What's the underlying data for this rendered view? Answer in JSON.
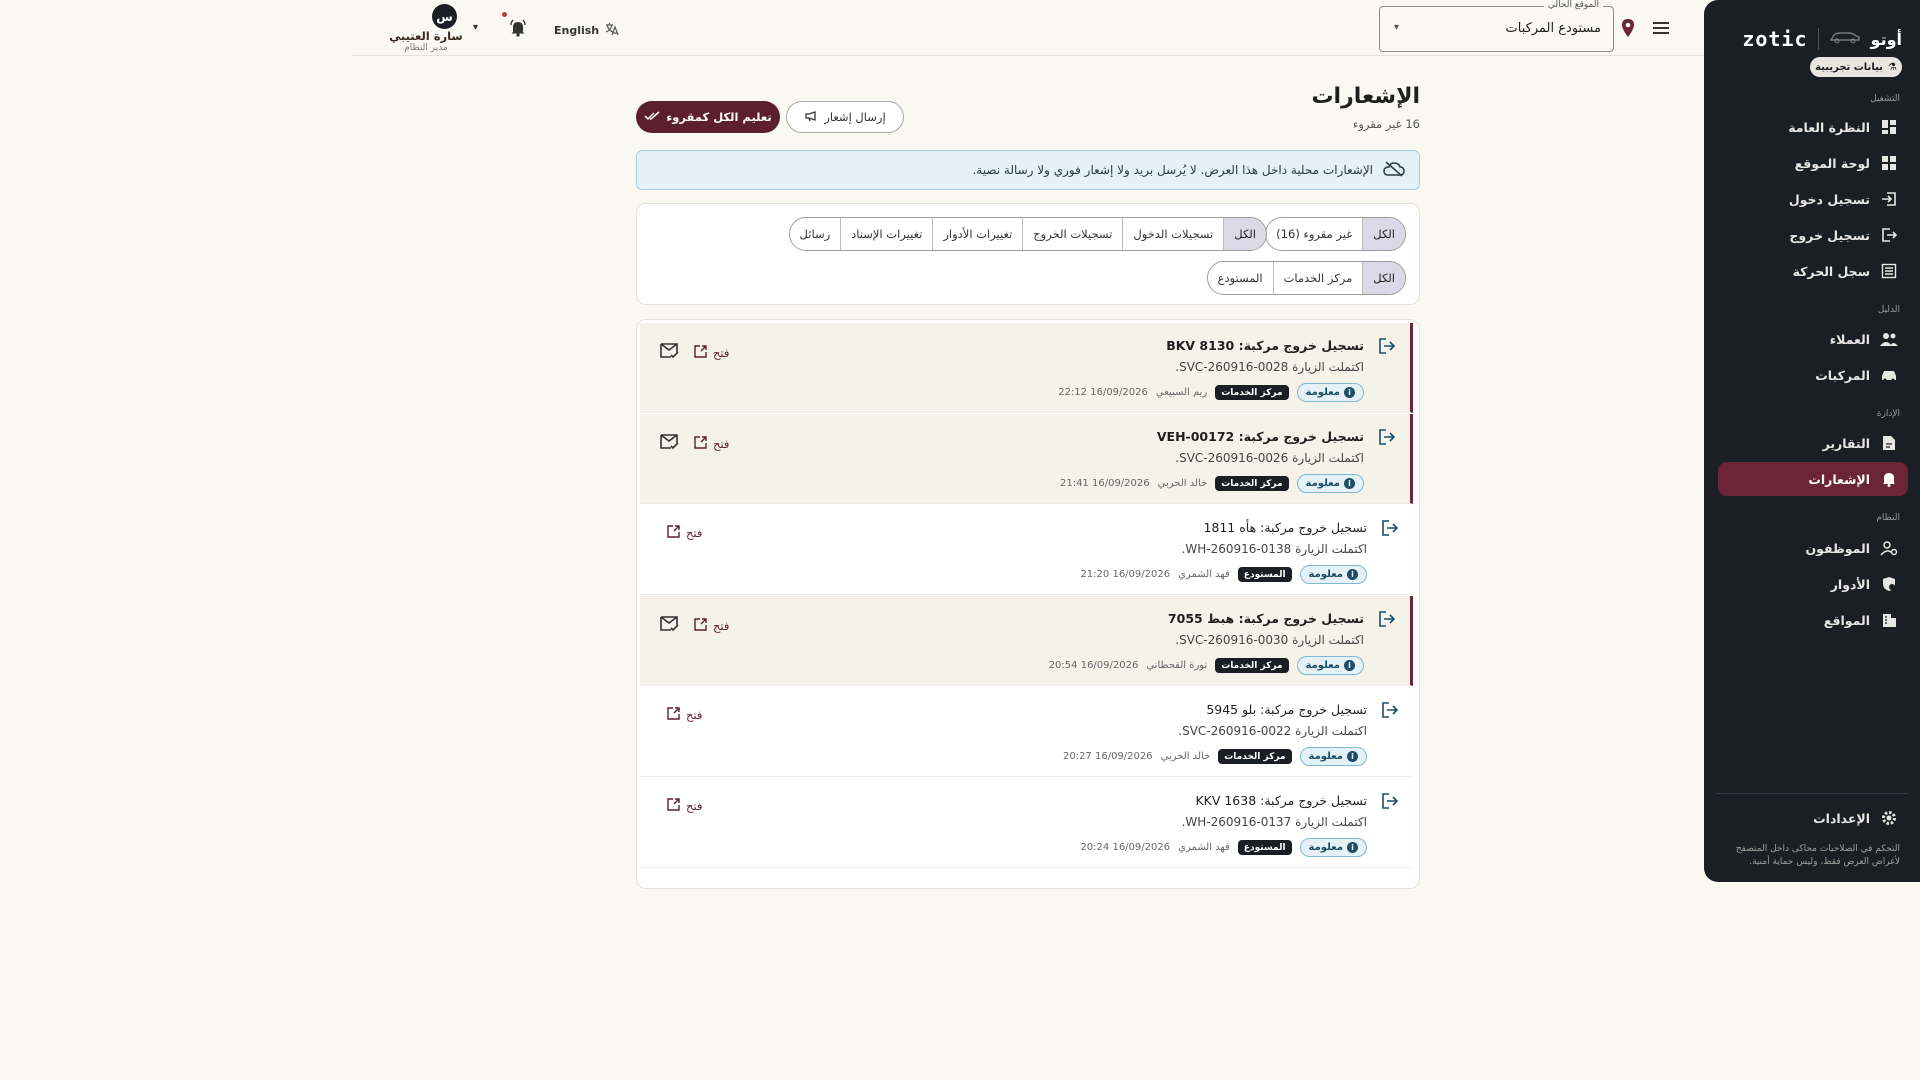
{
  "sidebar": {
    "brand_ar": "أوتو",
    "brand_logo": "zotic",
    "demo_badge": "بيانات تجريبية",
    "sections": {
      "operation": "التشغيل",
      "directory": "الدليل",
      "management": "الإدارة",
      "system": "النظام"
    },
    "items": [
      {
        "label": "النظرة العامة",
        "icon": "dashboard-icon"
      },
      {
        "label": "لوحة الموقع",
        "icon": "site-board-icon"
      },
      {
        "label": "تسجيل دخول",
        "icon": "login-icon"
      },
      {
        "label": "تسجيل خروج",
        "icon": "logout-icon"
      },
      {
        "label": "سجل الحركة",
        "icon": "log-icon"
      },
      {
        "label": "العملاء",
        "icon": "customers-icon"
      },
      {
        "label": "المركبات",
        "icon": "car-icon"
      },
      {
        "label": "التقارير",
        "icon": "report-icon"
      },
      {
        "label": "الإشعارات",
        "icon": "bell-icon",
        "active": true
      },
      {
        "label": "الموظفون",
        "icon": "staff-icon"
      },
      {
        "label": "الأدوار",
        "icon": "roles-icon"
      },
      {
        "label": "المواقع",
        "icon": "building-icon"
      }
    ],
    "settings": "الإعدادات",
    "footer_note": "التحكم في الصلاحيات محاكى داخل المتصفح لأغراض العرض فقط، وليس حماية أمنية."
  },
  "topbar": {
    "location_label": "الموقع الحالي",
    "location_value": "مستودع المركبات",
    "language": "English",
    "user_initial": "س",
    "user_name": "سارة العتيبي",
    "user_role": "مدير النظام"
  },
  "page": {
    "title": "الإشعارات",
    "unread_count_text": "16 غير مقروء",
    "mark_all_read": "تعليم الكل كمقروء",
    "send_notification": "إرسال إشعار",
    "info_banner": "الإشعارات محلية داخل هذا العرض. لا يُرسل بريد ولا إشعار فوري ولا رسالة نصية."
  },
  "filters": {
    "read_state": [
      "الكل",
      "غير مقروء (16)"
    ],
    "types": [
      "الكل",
      "تسجيلات الدخول",
      "تسجيلات الخروج",
      "تغييرات الأدوار",
      "تغييرات الإسناد",
      "رسائل"
    ],
    "locations": [
      "الكل",
      "مركز الخدمات",
      "المستودع"
    ]
  },
  "notifications": [
    {
      "title": "تسجيل خروج مركبة: BKV 8130",
      "body": "اكتملت الزيارة SVC-260916-0028.",
      "level": "معلومة",
      "location": "مركز الخدمات",
      "user": "ريم السبيعي",
      "time": "16/09/2026 22:12",
      "unread": true,
      "open": "فتح"
    },
    {
      "title": "تسجيل خروج مركبة: VEH-00172",
      "body": "اكتملت الزيارة SVC-260916-0026.",
      "level": "معلومة",
      "location": "مركز الخدمات",
      "user": "خالد الحربي",
      "time": "16/09/2026 21:41",
      "unread": true,
      "open": "فتح"
    },
    {
      "title": "تسجيل خروج مركبة: هأه 1811",
      "body": "اكتملت الزيارة WH-260916-0138.",
      "level": "معلومة",
      "location": "المستودع",
      "user": "فهد الشمري",
      "time": "16/09/2026 21:20",
      "unread": false,
      "open": "فتح"
    },
    {
      "title": "تسجيل خروج مركبة: هبط 7055",
      "body": "اكتملت الزيارة SVC-260916-0030.",
      "level": "معلومة",
      "location": "مركز الخدمات",
      "user": "نورة القحطاني",
      "time": "16/09/2026 20:54",
      "unread": true,
      "open": "فتح"
    },
    {
      "title": "تسجيل خروج مركبة: بلو 5945",
      "body": "اكتملت الزيارة SVC-260916-0022.",
      "level": "معلومة",
      "location": "مركز الخدمات",
      "user": "خالد الحربي",
      "time": "16/09/2026 20:27",
      "unread": false,
      "open": "فتح"
    },
    {
      "title": "تسجيل خروج مركبة: KKV 1638",
      "body": "اكتملت الزيارة WH-260916-0137.",
      "level": "معلومة",
      "location": "المستودع",
      "user": "فهد الشمري",
      "time": "16/09/2026 20:24",
      "unread": false,
      "open": "فتح"
    }
  ],
  "colors": {
    "accent": "#6b2438",
    "sidebar_bg": "#1b1e24",
    "info_bg": "#e4f1f6"
  }
}
